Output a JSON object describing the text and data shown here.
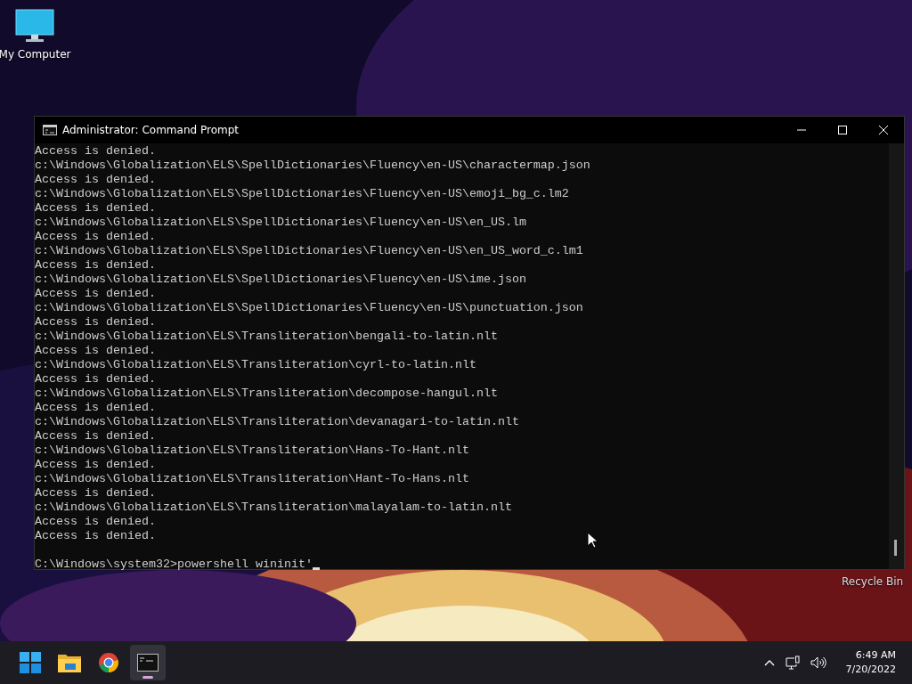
{
  "desktop_icons": [
    {
      "label": "My Computer",
      "kind": "computer"
    },
    {
      "label": "Recycle Bin",
      "kind": "recycle"
    }
  ],
  "window": {
    "title": "Administrator: Command Prompt",
    "lines": [
      "Access is denied.",
      "c:\\Windows\\Globalization\\ELS\\SpellDictionaries\\Fluency\\en-US\\charactermap.json",
      "Access is denied.",
      "c:\\Windows\\Globalization\\ELS\\SpellDictionaries\\Fluency\\en-US\\emoji_bg_c.lm2",
      "Access is denied.",
      "c:\\Windows\\Globalization\\ELS\\SpellDictionaries\\Fluency\\en-US\\en_US.lm",
      "Access is denied.",
      "c:\\Windows\\Globalization\\ELS\\SpellDictionaries\\Fluency\\en-US\\en_US_word_c.lm1",
      "Access is denied.",
      "c:\\Windows\\Globalization\\ELS\\SpellDictionaries\\Fluency\\en-US\\ime.json",
      "Access is denied.",
      "c:\\Windows\\Globalization\\ELS\\SpellDictionaries\\Fluency\\en-US\\punctuation.json",
      "Access is denied.",
      "c:\\Windows\\Globalization\\ELS\\Transliteration\\bengali-to-latin.nlt",
      "Access is denied.",
      "c:\\Windows\\Globalization\\ELS\\Transliteration\\cyrl-to-latin.nlt",
      "Access is denied.",
      "c:\\Windows\\Globalization\\ELS\\Transliteration\\decompose-hangul.nlt",
      "Access is denied.",
      "c:\\Windows\\Globalization\\ELS\\Transliteration\\devanagari-to-latin.nlt",
      "Access is denied.",
      "c:\\Windows\\Globalization\\ELS\\Transliteration\\Hans-To-Hant.nlt",
      "Access is denied.",
      "c:\\Windows\\Globalization\\ELS\\Transliteration\\Hant-To-Hans.nlt",
      "Access is denied.",
      "c:\\Windows\\Globalization\\ELS\\Transliteration\\malayalam-to-latin.nlt",
      "Access is denied.",
      "Access is denied."
    ],
    "prompt": "C:\\Windows\\system32>powershell wininit'"
  },
  "taskbar": {
    "apps": [
      {
        "kind": "start",
        "active": false
      },
      {
        "kind": "folder",
        "active": false
      },
      {
        "kind": "browser",
        "active": false
      },
      {
        "kind": "terminal",
        "active": true
      }
    ],
    "clock": {
      "time": "6:49 AM",
      "date": "7/20/2022"
    }
  }
}
